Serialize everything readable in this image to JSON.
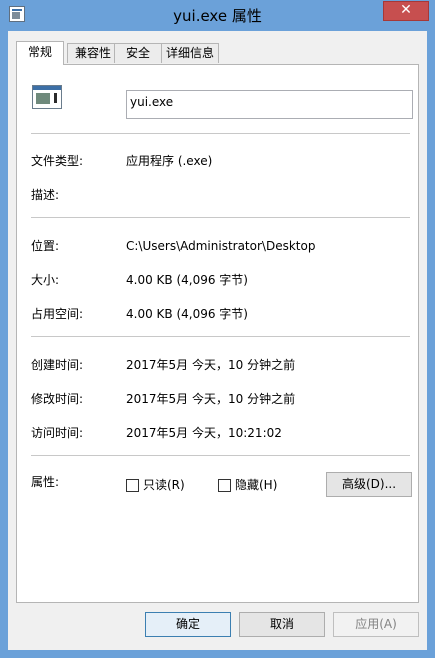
{
  "window": {
    "title": "yui.exe 属性",
    "close_glyph": "✕"
  },
  "tabs": [
    {
      "label": "常规",
      "active": true
    },
    {
      "label": "兼容性",
      "active": false
    },
    {
      "label": "安全",
      "active": false
    },
    {
      "label": "详细信息",
      "active": false
    }
  ],
  "general": {
    "filename": "yui.exe",
    "file_type_label": "文件类型:",
    "file_type_value": "应用程序 (.exe)",
    "description_label": "描述:",
    "description_value": "",
    "location_label": "位置:",
    "location_value": "C:\\Users\\Administrator\\Desktop",
    "size_label": "大小:",
    "size_value": "4.00 KB (4,096 字节)",
    "size_on_disk_label": "占用空间:",
    "size_on_disk_value": "4.00 KB (4,096 字节)",
    "created_label": "创建时间:",
    "created_value": "2017年5月 今天，10 分钟之前",
    "modified_label": "修改时间:",
    "modified_value": "2017年5月 今天，10 分钟之前",
    "accessed_label": "访问时间:",
    "accessed_value": "2017年5月 今天，10:21:02",
    "attributes_label": "属性:",
    "readonly_label": "只读(R)",
    "readonly_checked": false,
    "hidden_label": "隐藏(H)",
    "hidden_checked": false,
    "advanced_button": "高级(D)..."
  },
  "footer": {
    "ok": "确定",
    "cancel": "取消",
    "apply": "应用(A)",
    "apply_enabled": false
  }
}
